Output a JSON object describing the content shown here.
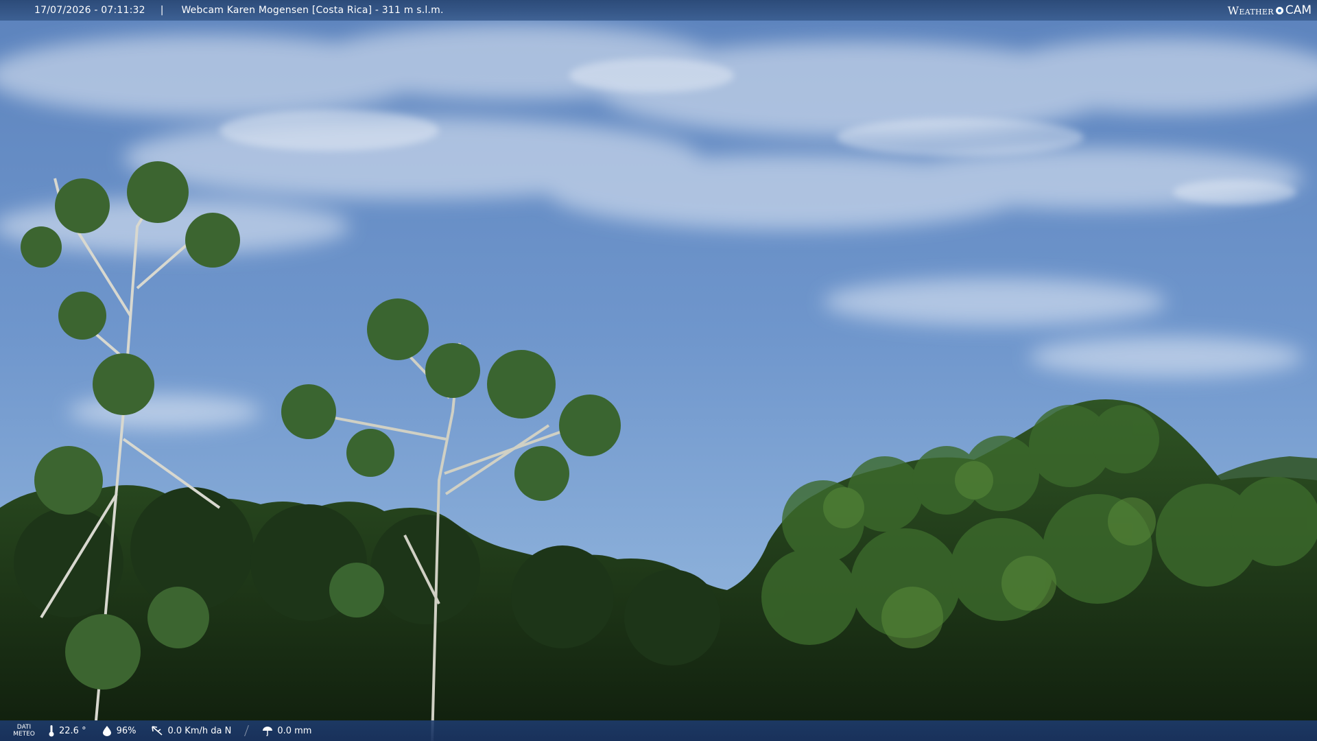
{
  "header": {
    "timestamp": "17/07/2026 - 07:11:32",
    "separator": "|",
    "title": "Webcam Karen Mogensen [Costa Rica] - 311 m s.l.m.",
    "logo_weather": "Weather",
    "logo_cam": "CAM"
  },
  "footer": {
    "label_line1": "DATI",
    "label_line2": "METEO",
    "temperature": "22.6 °",
    "humidity": "96%",
    "wind": "0.0 Km/h da N",
    "rain": "0.0 mm"
  },
  "icons": {
    "temperature": "thermometer-icon",
    "humidity": "droplet-icon",
    "wind": "wind-vane-icon",
    "rain": "umbrella-icon"
  },
  "colors": {
    "bar": "#2d5288",
    "sky_top": "#5c83bd",
    "sky_bottom": "#8cb0da",
    "foliage_dark": "#172b14",
    "foliage_light": "#3e6a2b"
  }
}
